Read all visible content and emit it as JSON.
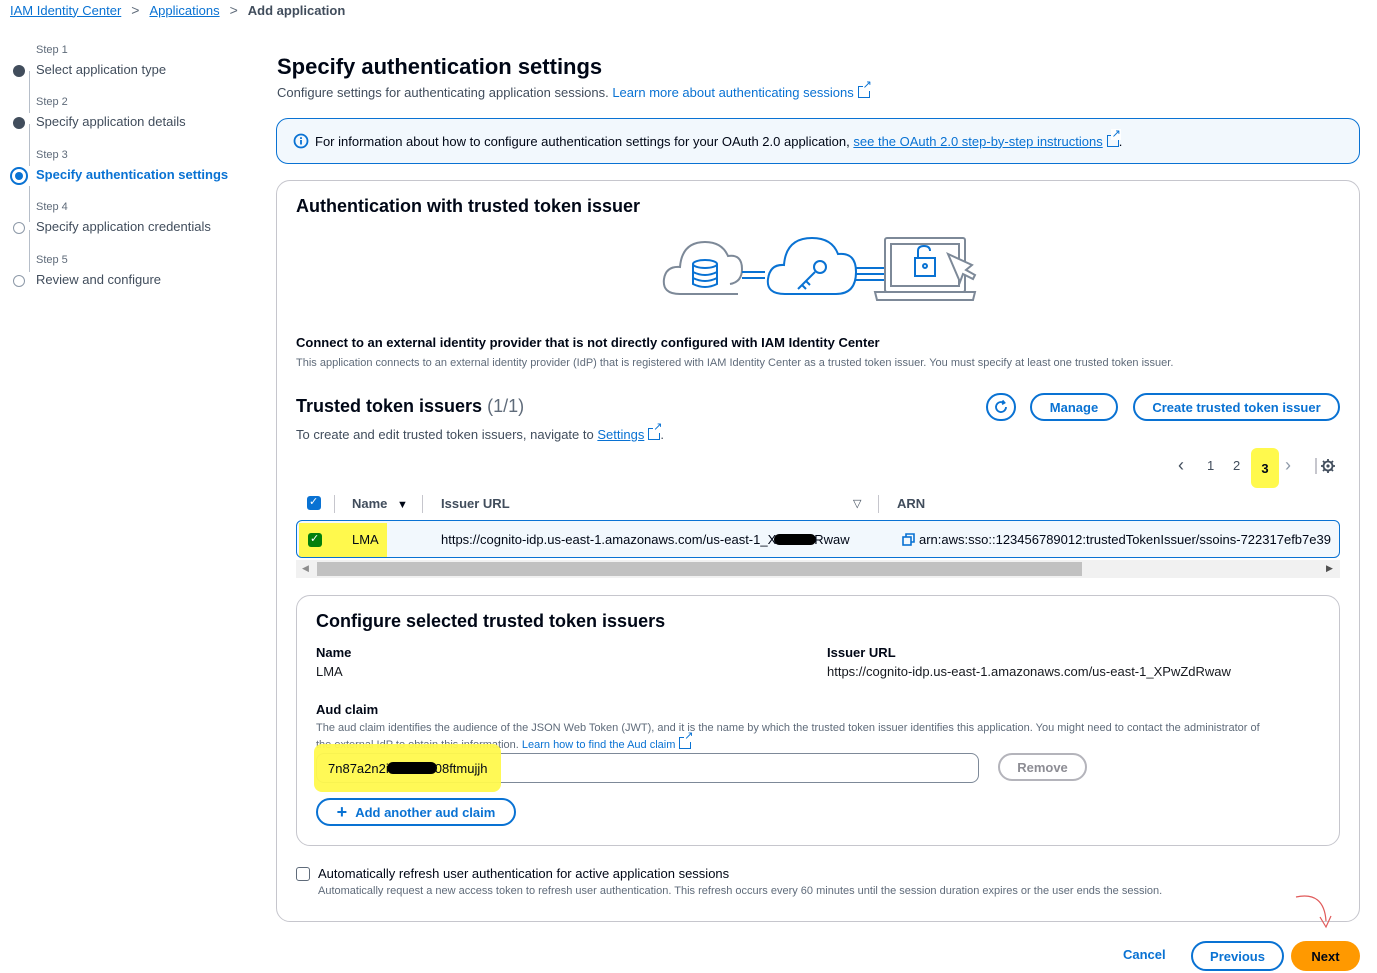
{
  "breadcrumb": {
    "item1": "IAM Identity Center",
    "item2": "Applications",
    "current": "Add application"
  },
  "steps": [
    {
      "num": "Step 1",
      "label": "Select application type"
    },
    {
      "num": "Step 2",
      "label": "Specify application details"
    },
    {
      "num": "Step 3",
      "label": "Specify authentication settings"
    },
    {
      "num": "Step 4",
      "label": "Specify application credentials"
    },
    {
      "num": "Step 5",
      "label": "Review and configure"
    }
  ],
  "header": {
    "title": "Specify authentication settings",
    "description": "Configure settings for authenticating application sessions.",
    "learn_more": "Learn more about authenticating sessions"
  },
  "info_alert": {
    "text": "For information about how to configure authentication settings for your OAuth 2.0 application,",
    "link": "see the OAuth 2.0 step-by-step instructions",
    "end": "."
  },
  "auth_section": {
    "title": "Authentication with trusted token issuer",
    "connect_title": "Connect to an external identity provider that is not directly configured with IAM Identity Center",
    "connect_desc": "This application connects to an external identity provider (IdP) that is registered with IAM Identity Center as a trusted token issuer. You must specify at least one trusted token issuer."
  },
  "issuers": {
    "title": "Trusted token issuers",
    "count": "(1/1)",
    "desc": "To create and edit trusted token issuers, navigate to",
    "settings_link": "Settings",
    "desc_end": ".",
    "manage_label": "Manage",
    "create_label": "Create trusted token issuer",
    "pages": [
      "1",
      "2",
      "3"
    ],
    "columns": {
      "name": "Name",
      "issuer_url": "Issuer URL",
      "arn": "ARN"
    },
    "rows": [
      {
        "name": "LMA",
        "issuer_url": "https://cognito-idp.us-east-1.amazonaws.com/us-east-1_X",
        "issuer_url_end": "Rwaw",
        "arn": "arn:aws:sso::123456789012:trustedTokenIssuer/ssoins-722317efb7e39"
      }
    ]
  },
  "configure": {
    "title": "Configure selected trusted token issuers",
    "name_label": "Name",
    "name_value": "LMA",
    "url_label": "Issuer URL",
    "url_value": "https://cognito-idp.us-east-1.amazonaws.com/us-east-1_XPwZdRwaw",
    "aud_label": "Aud claim",
    "aud_desc1": "The aud claim identifies the audience of the JSON Web Token (JWT), and it is the name by which the trusted token issuer identifies this application. You might need to contact the administrator of",
    "aud_desc2": "the external IdP to obtain this information.",
    "aud_link": "Learn how to find the Aud claim",
    "aud_value_start": "7n87a2n2i",
    "aud_value_end": "08ftmujjh",
    "remove_label": "Remove",
    "add_label": "Add another aud claim"
  },
  "refresh": {
    "label": "Automatically refresh user authentication for active application sessions",
    "desc": "Automatically request a new access token to refresh user authentication. This refresh occurs every 60 minutes until the session duration expires or the user ends the session."
  },
  "footer": {
    "cancel": "Cancel",
    "previous": "Previous",
    "next": "Next"
  },
  "colors": {
    "accent": "#0972d3",
    "primary": "#ff9900",
    "highlight": "#fff94d"
  }
}
